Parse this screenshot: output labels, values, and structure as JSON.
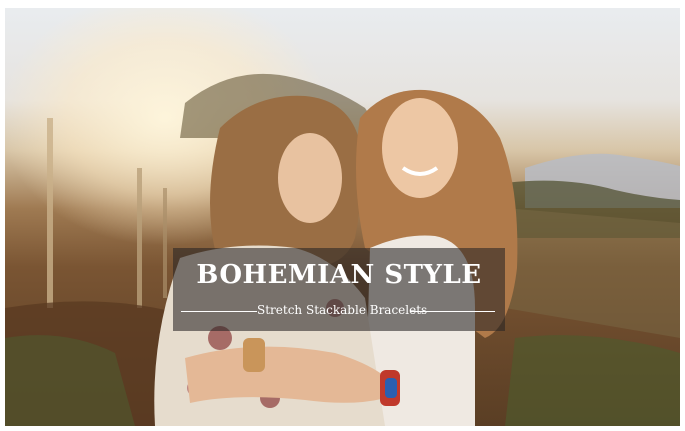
{
  "banner": {
    "title": "BOHEMIAN STYLE",
    "subtitle": "Stretch Stackable Bracelets"
  },
  "colors": {
    "banner_bg": "#282424",
    "text": "#ffffff",
    "sky": "#e9ecef",
    "hair_light": "#b88a5a",
    "dress_white": "#efe9e2",
    "floral": "#8a3a3a"
  }
}
